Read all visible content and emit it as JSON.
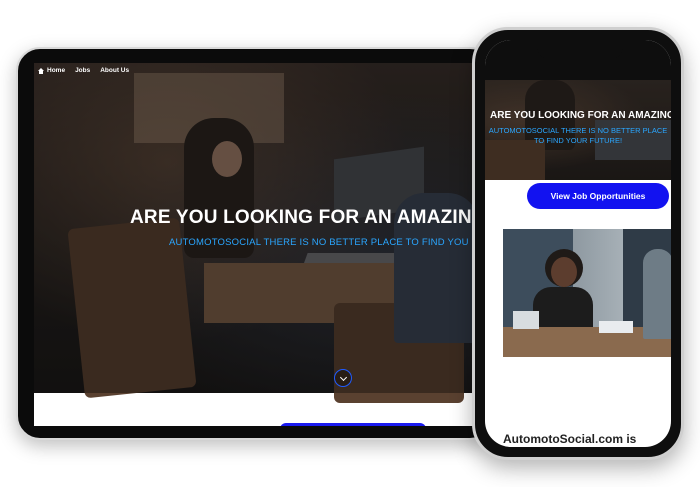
{
  "tablet": {
    "nav": {
      "home": "Home",
      "jobs": "Jobs",
      "about": "About Us"
    },
    "hero": {
      "title": "ARE YOU LOOKING FOR AN AMAZING",
      "subtitle": "AUTOMOTOSOCIAL THERE IS NO BETTER PLACE TO FIND YOU"
    }
  },
  "phone": {
    "hero": {
      "title": "ARE YOU LOOKING FOR AN AMAZING CA",
      "subtitle": "AUTOMOTOSOCIAL THERE IS NO BETTER PLACE TO FIND YOUR FUTURE!"
    },
    "cta_label": "View Job Opportunities",
    "footer_text": "AutomotoSocial.com is"
  },
  "colors": {
    "accent_blue": "#1212f0",
    "subtitle_blue": "#2aa6ff"
  },
  "icons": [
    "home-icon",
    "chevron-down-icon"
  ]
}
